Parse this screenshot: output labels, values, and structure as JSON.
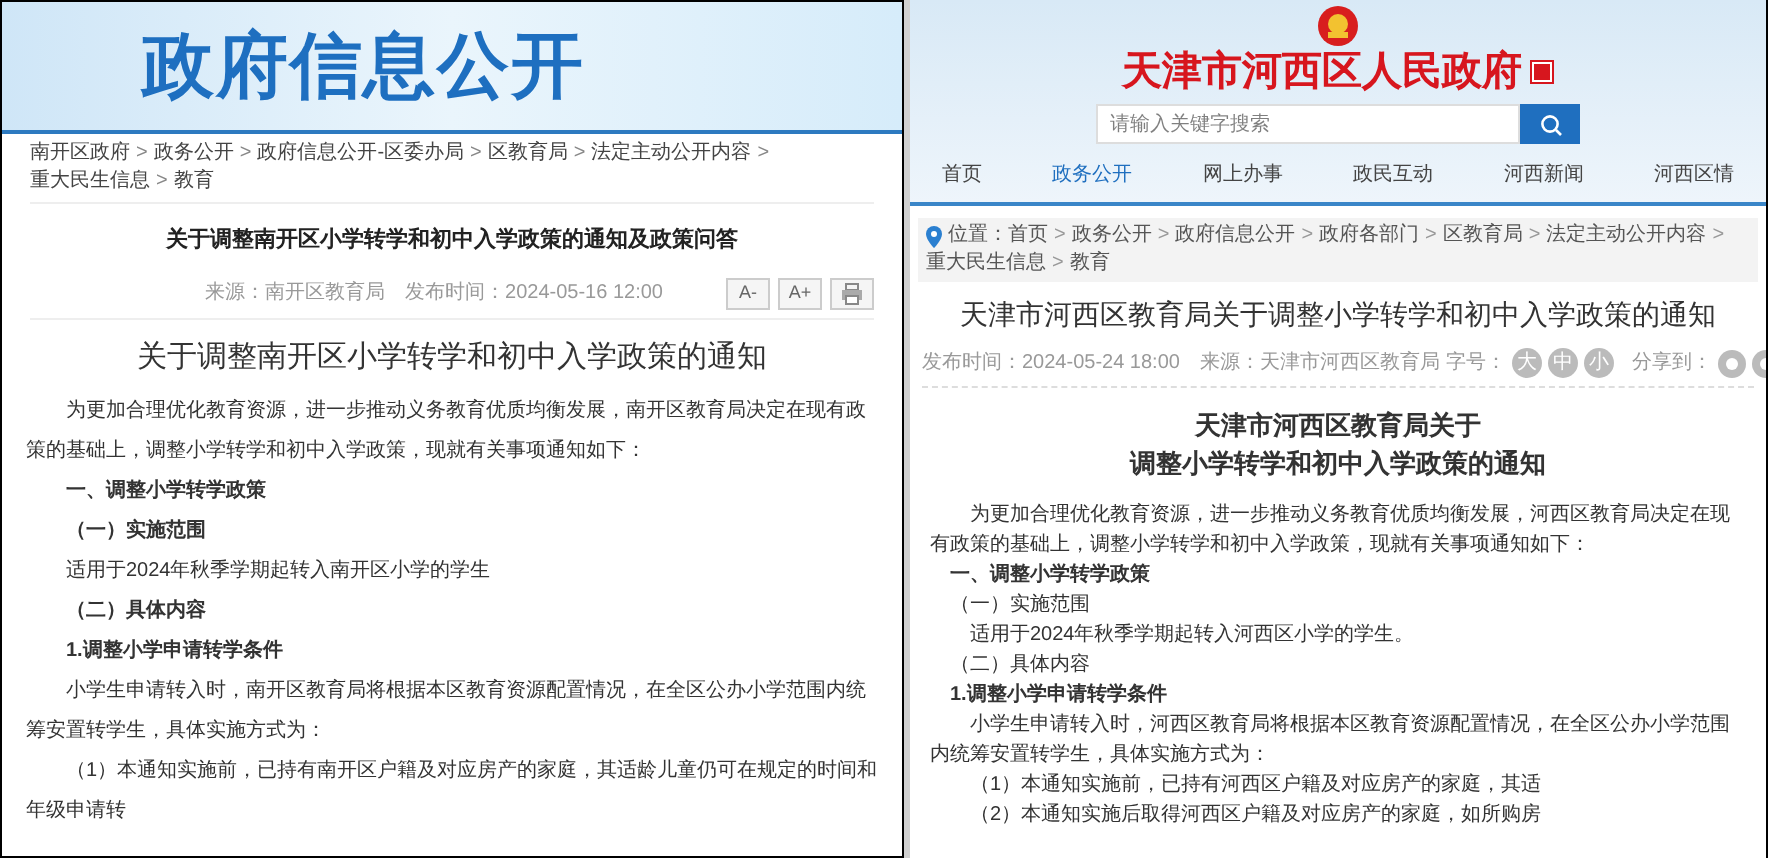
{
  "left_page": {
    "banner_title": "政府信息公开",
    "breadcrumb_separator": ">",
    "breadcrumb": [
      "南开区政府",
      "政务公开",
      "政府信息公开-区委办局",
      "区教育局",
      "法定主动公开内容",
      "重大民生信息",
      "教育"
    ],
    "page_title": "关于调整南开区小学转学和初中入学政策的通知及政策问答",
    "meta": "来源：南开区教育局　发布时间：2024-05-16 12:00",
    "font_buttons": [
      "A-",
      "A+"
    ],
    "doc_title": "关于调整南开区小学转学和初中入学政策的通知",
    "body": [
      {
        "kind": "paragraph",
        "bold": false,
        "text": "为更加合理优化教育资源，进一步推动义务教育优质均衡发展，南开区教育局决定在现有政策的基础上，调整小学转学和初中入学政策，现就有关事项通知如下："
      },
      {
        "kind": "heading",
        "bold": true,
        "text": "一、调整小学转学政策"
      },
      {
        "kind": "heading",
        "bold": true,
        "text": "（一）实施范围"
      },
      {
        "kind": "paragraph",
        "bold": false,
        "text": "适用于2024年秋季学期起转入南开区小学的学生"
      },
      {
        "kind": "heading",
        "bold": true,
        "text": "（二）具体内容"
      },
      {
        "kind": "heading",
        "bold": true,
        "text": "1.调整小学申请转学条件"
      },
      {
        "kind": "paragraph",
        "bold": false,
        "text": "小学生申请转入时，南开区教育局将根据本区教育资源配置情况，在全区公办小学范围内统筹安置转学生，具体实施方式为："
      },
      {
        "kind": "paragraph",
        "bold": false,
        "text": "（1）本通知实施前，已持有南开区户籍及对应房产的家庭，其适龄儿童仍可在规定的时间和年级申请转"
      }
    ]
  },
  "right_page": {
    "site_title": "天津市河西区人民政府",
    "search": {
      "placeholder": "请输入关键字搜索"
    },
    "nav": [
      {
        "label": "首页",
        "selected": false
      },
      {
        "label": "政务公开",
        "selected": true
      },
      {
        "label": "网上办事",
        "selected": false
      },
      {
        "label": "政民互动",
        "selected": false
      },
      {
        "label": "河西新闻",
        "selected": false
      },
      {
        "label": "河西区情",
        "selected": false
      }
    ],
    "breadcrumb_label": "位置：",
    "breadcrumb_separator": ">",
    "breadcrumb": [
      "首页",
      "政务公开",
      "政府信息公开",
      "政府各部门",
      "区教育局",
      "法定主动公开内容",
      "重大民生信息",
      "教育"
    ],
    "page_title": "天津市河西区教育局关于调整小学转学和初中入学政策的通知",
    "meta": "发布时间：2024-05-24 18:00　来源：天津市河西区教育局",
    "font_size_label": "字号：",
    "font_sizes": [
      "大",
      "中",
      "小"
    ],
    "share_label": "分享到：",
    "doc_title_lines": [
      "天津市河西区教育局关于",
      "调整小学转学和初中入学政策的通知"
    ],
    "body": [
      {
        "kind": "paragraph",
        "bold": false,
        "text": "为更加合理优化教育资源，进一步推动义务教育优质均衡发展，河西区教育局决定在现有政策的基础上，调整小学转学和初中入学政策，现就有关事项通知如下："
      },
      {
        "kind": "heading",
        "bold": true,
        "text": "一、调整小学转学政策"
      },
      {
        "kind": "heading",
        "bold": false,
        "text": "（一）实施范围"
      },
      {
        "kind": "paragraph",
        "bold": false,
        "text": "适用于2024年秋季学期起转入河西区小学的学生。"
      },
      {
        "kind": "heading",
        "bold": false,
        "text": "（二）具体内容"
      },
      {
        "kind": "heading",
        "bold": true,
        "text": "1.调整小学申请转学条件"
      },
      {
        "kind": "paragraph",
        "bold": false,
        "text": "小学生申请转入时，河西区教育局将根据本区教育资源配置情况，在全区公办小学范围内统筹安置转学生，具体实施方式为："
      },
      {
        "kind": "paragraph",
        "bold": false,
        "text": "（1）本通知实施前，已持有河西区户籍及对应房产的家庭，其适"
      },
      {
        "kind": "paragraph",
        "bold": false,
        "text": "（2）本通知实施后取得河西区户籍及对应房产的家庭，如所购房"
      }
    ]
  }
}
